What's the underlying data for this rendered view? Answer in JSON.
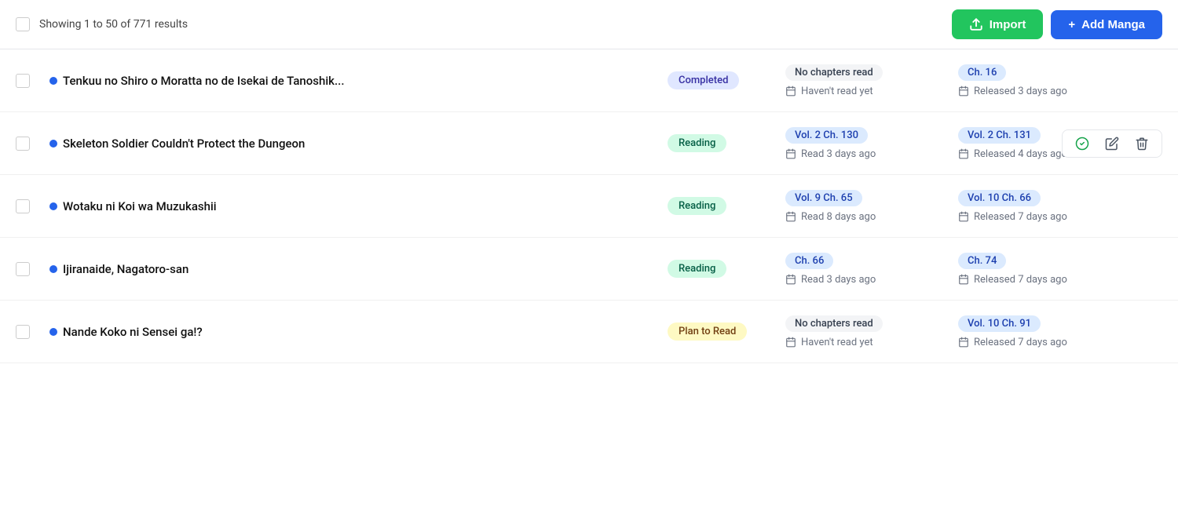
{
  "header": {
    "showing_text": "Showing 1 to 50 of 771 results",
    "import_label": "Import",
    "add_label": "Add Manga"
  },
  "rows": [
    {
      "id": 1,
      "title": "Tenkuu no Shiro o Moratta no de Isekai de Tanoshik...",
      "status": "Completed",
      "status_type": "completed",
      "read_chapter": "No chapters read",
      "read_chapter_type": "none",
      "read_date": "Haven't read yet",
      "latest_chapter": "Ch. 16",
      "released_date": "Released 3 days ago",
      "show_actions": false
    },
    {
      "id": 2,
      "title": "Skeleton Soldier Couldn't Protect the Dungeon",
      "status": "Reading",
      "status_type": "reading",
      "read_chapter": "Vol. 2 Ch. 130",
      "read_chapter_type": "chapter",
      "read_date": "Read 3 days ago",
      "latest_chapter": "Vol. 2 Ch. 131",
      "released_date": "Released 4 days ago",
      "show_actions": true
    },
    {
      "id": 3,
      "title": "Wotaku ni Koi wa Muzukashii",
      "status": "Reading",
      "status_type": "reading",
      "read_chapter": "Vol. 9 Ch. 65",
      "read_chapter_type": "chapter",
      "read_date": "Read 8 days ago",
      "latest_chapter": "Vol. 10 Ch. 66",
      "released_date": "Released 7 days ago",
      "show_actions": false
    },
    {
      "id": 4,
      "title": "Ijiranaide, Nagatoro-san",
      "status": "Reading",
      "status_type": "reading",
      "read_chapter": "Ch. 66",
      "read_chapter_type": "chapter",
      "read_date": "Read 3 days ago",
      "latest_chapter": "Ch. 74",
      "released_date": "Released 7 days ago",
      "show_actions": false
    },
    {
      "id": 5,
      "title": "Nande Koko ni Sensei ga!?",
      "status": "Plan to Read",
      "status_type": "plan",
      "read_chapter": "No chapters read",
      "read_chapter_type": "none",
      "read_date": "Haven't read yet",
      "latest_chapter": "Vol. 10 Ch. 91",
      "released_date": "Released 7 days ago",
      "show_actions": false
    }
  ],
  "icons": {
    "upload": "⬆",
    "plus": "+",
    "calendar": "📅",
    "check": "✓",
    "edit": "✎",
    "delete": "🗑"
  }
}
